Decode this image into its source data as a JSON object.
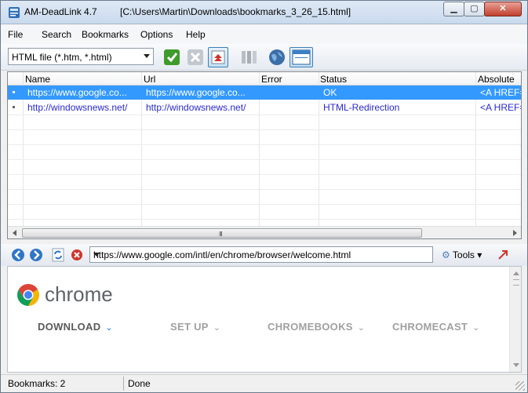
{
  "window": {
    "app_title": "AM-DeadLink 4.7",
    "file_path": "[C:\\Users\\Martin\\Downloads\\bookmarks_3_26_15.html]",
    "minimize_glyph": "▁",
    "maximize_glyph": "▢",
    "close_glyph": "✕"
  },
  "menu": [
    "File",
    "Search",
    "Bookmarks",
    "Options",
    "Help"
  ],
  "toolbar": {
    "file_type_selected": "HTML file (*.htm, *.html)",
    "icons": [
      "check-icon",
      "delete-icon",
      "export-icon",
      "columns-icon",
      "globe-icon",
      "browser-view-icon"
    ]
  },
  "list": {
    "columns": [
      "Name",
      "Url",
      "Error",
      "Status",
      "Absolute P"
    ],
    "rows": [
      {
        "name": "https://www.google.co...",
        "url": "https://www.google.co...",
        "error": "",
        "status": "OK",
        "absolute": "<A HREF="
      },
      {
        "name": "http://windowsnews.net/",
        "url": "http://windowsnews.net/",
        "error": "",
        "status": "HTML-Redirection",
        "absolute": "<A HREF="
      }
    ],
    "scroll_grip": "III"
  },
  "browser": {
    "url": "https://www.google.com/intl/en/chrome/browser/welcome.html",
    "tools_label": "Tools",
    "tools_arrow": "▾"
  },
  "webpage": {
    "brand": "chrome",
    "nav": [
      "DOWNLOAD",
      "SET UP",
      "CHROMEBOOKS",
      "CHROMECAST"
    ],
    "chevron": "⌄"
  },
  "status": {
    "bookmarks": "Bookmarks: 2",
    "state": "Done"
  },
  "colors": {
    "selection": "#3399ff",
    "link_text": "#2a2acc",
    "chrome_gray": "#5f6368",
    "download_chevron": "#1a73e8"
  }
}
